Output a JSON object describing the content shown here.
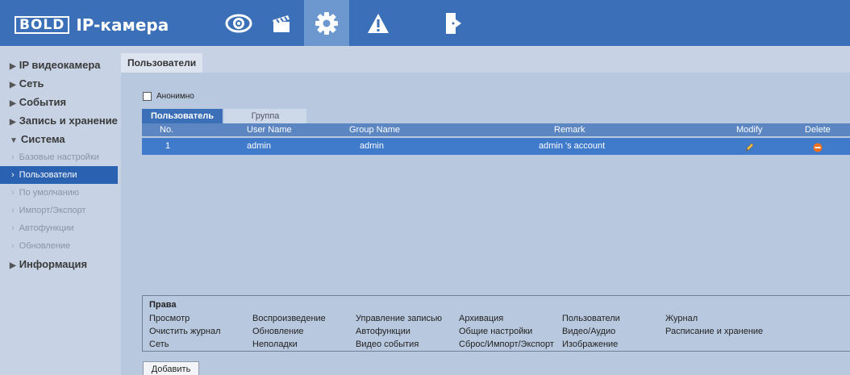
{
  "header": {
    "logo_box": "BOLD",
    "logo_text": "IP-камера",
    "nav": [
      "eye-icon",
      "clapperboard-icon",
      "gear-icon",
      "warning-icon",
      "exit-icon"
    ],
    "active_nav": "gear-icon",
    "colors": {
      "bar": "#3b6fb7",
      "active": "#6c97cf"
    }
  },
  "sidebar": {
    "sections": [
      {
        "label": "IP видеокамера",
        "expanded": false
      },
      {
        "label": "Сеть",
        "expanded": false
      },
      {
        "label": "События",
        "expanded": false
      },
      {
        "label": "Запись и хранение",
        "expanded": false
      },
      {
        "label": "Система",
        "expanded": true
      }
    ],
    "system_items": [
      "Базовые настройки",
      "Пользователи",
      "По умолчанию",
      "Импорт/Экспорт",
      "Автофункции",
      "Обновление"
    ],
    "active_item": "Пользователи",
    "last_section": {
      "label": "Информация",
      "expanded": false
    }
  },
  "main": {
    "tab": "Пользователи",
    "anonymous_label": "Анонимно",
    "anonymous_checked": false,
    "subtabs": [
      "Пользователь",
      "Группа"
    ],
    "active_subtab": "Пользователь",
    "table": {
      "headers": [
        "No.",
        "User Name",
        "Group Name",
        "Remark",
        "Modify",
        "Delete"
      ],
      "rows": [
        {
          "no": "1",
          "user": "admin",
          "group": "admin",
          "remark": "admin 's account"
        }
      ]
    },
    "rights": {
      "title": "Права",
      "items": [
        [
          "Просмотр",
          "Воспроизведение",
          "Управление записью",
          "Архивация",
          "Пользователи",
          "Журнал"
        ],
        [
          "Очистить журнал",
          "Обновление",
          "Автофункции",
          "Общие настройки",
          "Видео/Аудио",
          "Расписание и хранение"
        ],
        [
          "Сеть",
          "Неполадки",
          "Видео события",
          "Сброс/Импорт/Экспорт",
          "Изображение"
        ]
      ]
    },
    "add_button": "Добавить"
  }
}
